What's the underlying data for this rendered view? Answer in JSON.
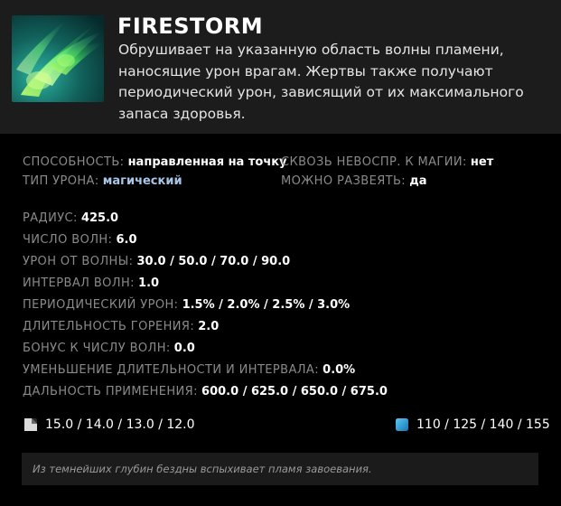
{
  "ability": {
    "name": "FIRESTORM",
    "description": "Обрушивает на указанную область волны пламени, наносящие урон врагам. Жертвы также получают периодический урон, зависящий от их максимального запаса здоровья."
  },
  "attributes": {
    "ability_type": {
      "label": "СПОСОБНОСТЬ:",
      "value": "направленная на точку"
    },
    "pierce_immunity": {
      "label": "СКВОЗЬ НЕВОСПР. К МАГИИ:",
      "value": "нет"
    },
    "damage_type": {
      "label": "ТИП УРОНА:",
      "value": "магический"
    },
    "dispellable": {
      "label": "МОЖНО РАЗВЕЯТЬ:",
      "value": "да"
    }
  },
  "stats": [
    {
      "label": "РАДИУС:",
      "value": "425.0"
    },
    {
      "label": "ЧИСЛО ВОЛН:",
      "value": "6.0"
    },
    {
      "label": "УРОН ОТ ВОЛНЫ:",
      "value": "30.0 / 50.0 / 70.0 / 90.0"
    },
    {
      "label": "ИНТЕРВАЛ ВОЛН:",
      "value": "1.0"
    },
    {
      "label": "ПЕРИОДИЧЕСКИЙ УРОН:",
      "value": "1.5% / 2.0% / 2.5% / 3.0%"
    },
    {
      "label": "ДЛИТЕЛЬНОСТЬ ГОРЕНИЯ:",
      "value": "2.0"
    },
    {
      "label": "БОНУС К ЧИСЛУ ВОЛН:",
      "value": "0.0"
    },
    {
      "label": "УМЕНЬШЕНИЕ ДЛИТЕЛЬНОСТИ И ИНТЕРВАЛА:",
      "value": "0.0%"
    },
    {
      "label": "ДАЛЬНОСТЬ ПРИМЕНЕНИЯ:",
      "value": "600.0 / 625.0 / 650.0 / 675.0"
    }
  ],
  "cooldown": {
    "icon": "cooldown-icon",
    "value": "15.0 / 14.0 / 13.0 / 12.0"
  },
  "mana_cost": {
    "icon": "mana-icon",
    "value": "110 / 125 / 140 / 155",
    "color": "#1f8fc9"
  },
  "lore": "Из темнейших глубин бездны вспыхивает пламя завоевания.",
  "colors": {
    "header_bg": "#1c1c1c",
    "body_bg": "#000000",
    "label": "#8a8a8a",
    "value": "#ffffff",
    "magic_damage": "#a8c7e8",
    "lore_bg": "#1b1b1b"
  }
}
